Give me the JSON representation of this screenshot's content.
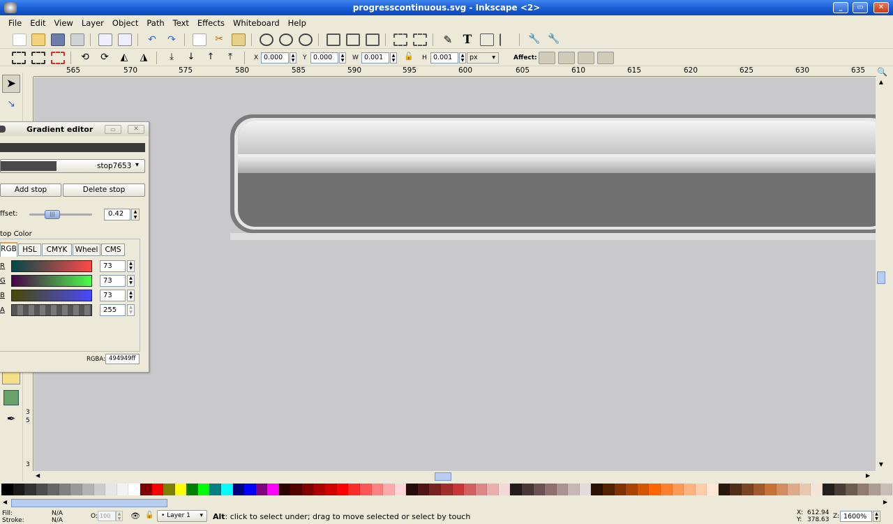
{
  "window": {
    "title": "progresscontinuous.svg - Inkscape <2>"
  },
  "menu": [
    "File",
    "Edit",
    "View",
    "Layer",
    "Object",
    "Path",
    "Text",
    "Effects",
    "Whiteboard",
    "Help"
  ],
  "toolctrl": {
    "x_label": "X",
    "x": "0.000",
    "y_label": "Y",
    "y": "0.000",
    "w_label": "W",
    "w": "0.001",
    "h_label": "H",
    "h": "0.001",
    "unit": "px",
    "affect": "Affect:"
  },
  "ruler": {
    "h": [
      "565",
      "570",
      "575",
      "580",
      "585",
      "590",
      "595",
      "600",
      "605",
      "610",
      "615",
      "620",
      "625",
      "630",
      "635"
    ],
    "v": [
      "3",
      "5",
      "3"
    ]
  },
  "gradient_editor": {
    "title": "Gradient editor",
    "stop_name": "stop7653",
    "add_stop": "Add stop",
    "delete_stop": "Delete stop",
    "offset_label": "ffset:",
    "offset": "0.42",
    "stop_color_label": "top Color",
    "tabs": [
      "RGB",
      "HSL",
      "CMYK",
      "Wheel",
      "CMS"
    ],
    "channels": [
      {
        "name": "R",
        "value": "73"
      },
      {
        "name": "G",
        "value": "73"
      },
      {
        "name": "B",
        "value": "73"
      },
      {
        "name": "A",
        "value": "255"
      }
    ],
    "rgba_label": "RGBA:",
    "rgba": "494949ff"
  },
  "status": {
    "fill_label": "Fill:",
    "fill": "N/A",
    "stroke_label": "Stroke:",
    "stroke": "N/A",
    "opacity_label": "O:",
    "opacity": "100",
    "layer": "Layer 1",
    "message_bold": "Alt",
    "message": ": click to select under; drag to move selected or select by touch",
    "x_label": "X:",
    "x": "612.94",
    "y_label": "Y:",
    "y": "378.63",
    "zoom_label": "Z:",
    "zoom": "1600%"
  },
  "palette": [
    "#000000",
    "#1a1a1a",
    "#333333",
    "#4d4d4d",
    "#666666",
    "#808080",
    "#999999",
    "#b3b3b3",
    "#cccccc",
    "#e6e6e6",
    "#f2f2f2",
    "#ffffff",
    "#800000",
    "#ff0000",
    "#808000",
    "#ffff00",
    "#008000",
    "#00ff00",
    "#008080",
    "#00ffff",
    "#000080",
    "#0000ff",
    "#800080",
    "#ff00ff",
    "#2b0000",
    "#550000",
    "#800000",
    "#aa0000",
    "#d40000",
    "#ff0000",
    "#ff2a2a",
    "#ff5555",
    "#ff8080",
    "#ffaaaa",
    "#ffd5d5",
    "#280b0b",
    "#501616",
    "#782121",
    "#a02c2c",
    "#c83737",
    "#d35f5f",
    "#de8787",
    "#e9afaf",
    "#f4d7d7",
    "#241c1c",
    "#483737",
    "#6c5353",
    "#916f6f",
    "#ac9393",
    "#c8b7b7",
    "#e3dbdb",
    "#2b1100",
    "#552200",
    "#803300",
    "#aa4400",
    "#d45500",
    "#ff6600",
    "#ff7f2a",
    "#ff9955",
    "#ffb380",
    "#ffccaa",
    "#ffe6d5",
    "#28170b",
    "#502d16",
    "#784421",
    "#a05a2c",
    "#c87137",
    "#d38d5f",
    "#deaa87",
    "#e9c6af",
    "#f4e3d7",
    "#241f1c",
    "#483e37",
    "#6c5d53",
    "#917c6f",
    "#ac9d93",
    "#c8beb7"
  ]
}
